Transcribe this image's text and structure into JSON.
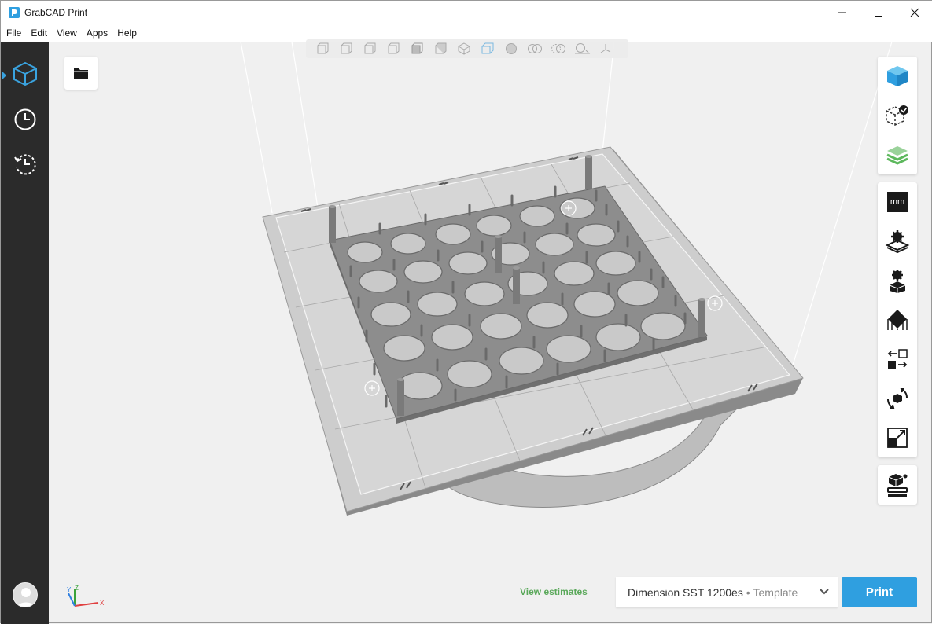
{
  "window": {
    "title": "GrabCAD Print"
  },
  "menu": [
    "File",
    "Edit",
    "View",
    "Apps",
    "Help"
  ],
  "sidebar": {
    "items": [
      {
        "icon": "model-cube-icon",
        "active": true
      },
      {
        "icon": "clock-icon",
        "active": false
      },
      {
        "icon": "history-icon",
        "active": false
      }
    ]
  },
  "view_toolbar": [
    "front-view-icon",
    "back-view-icon",
    "left-view-icon",
    "right-view-icon",
    "top-view-icon",
    "bottom-view-icon",
    "iso-view-icon",
    "perspective-view-icon",
    "shaded-sphere-icon",
    "show-models-icon",
    "show-support-icon",
    "show-section-icon",
    "axis-gizmo-icon"
  ],
  "right_toolbar": {
    "group1": [
      "model-view-icon",
      "model-check-icon",
      "slice-layers-icon"
    ],
    "group2_units": "mm",
    "group2": [
      "tray-settings-icon",
      "model-settings-icon",
      "orient-face-icon",
      "arrange-icon",
      "rotate-icon",
      "scale-icon"
    ],
    "group3": [
      "add-to-tray-icon"
    ]
  },
  "bottom": {
    "estimates_label": "View estimates",
    "printer_name": "Dimension SST 1200es",
    "printer_sep": " • ",
    "printer_mode": "Template",
    "print_label": "Print"
  },
  "colors": {
    "accent": "#2f9fe0",
    "sidebar": "#2b2b2b",
    "link": "#5aa85a",
    "model": "#8c8c8c",
    "tray": "#cfcfcf"
  }
}
